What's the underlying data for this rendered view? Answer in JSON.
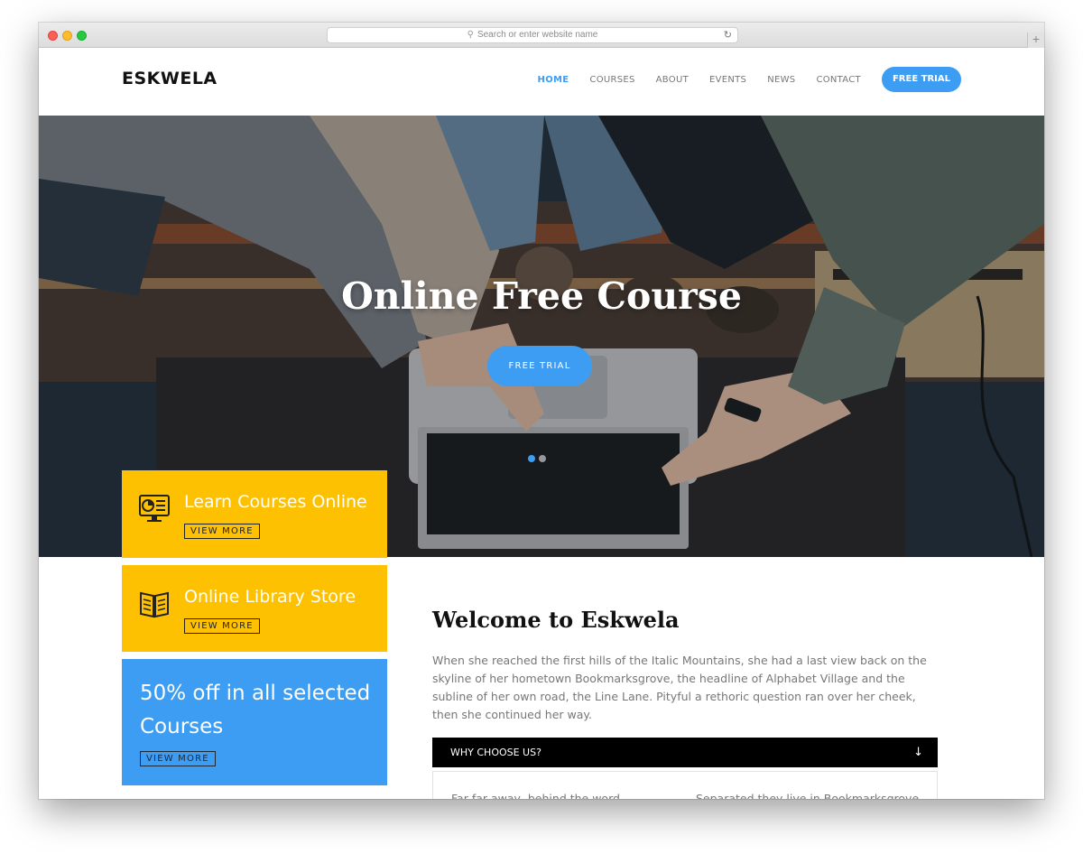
{
  "browser": {
    "address_placeholder": "Search or enter website name",
    "new_tab_label": "+"
  },
  "site": {
    "logo": "ESKWELA",
    "nav": [
      "HOME",
      "COURSES",
      "ABOUT",
      "EVENTS",
      "NEWS",
      "CONTACT"
    ],
    "nav_active": "HOME",
    "cta": "FREE TRIAL"
  },
  "hero": {
    "title": "Online Free Course",
    "button": "FREE TRIAL",
    "slides": 2,
    "active_slide": 1
  },
  "features": [
    {
      "title": "Learn Courses Online",
      "button": "VIEW MORE",
      "icon": "monitor-chart-icon"
    },
    {
      "title": "Online Library Store",
      "button": "VIEW MORE",
      "icon": "book-icon"
    },
    {
      "title": "50% off in all selected Courses",
      "button": "VIEW MORE"
    }
  ],
  "welcome": {
    "title": "Welcome to Eskwela",
    "body": "When she reached the first hills of the Italic Mountains, she had a last view back on the skyline of her hometown Bookmarksgrove, the headline of Alphabet Village and the subline of her own road, the Line Lane. Pityful a rethoric question ran over her cheek, then she continued her way.",
    "accordion": {
      "title": "WHY CHOOSE US?",
      "col1": "Far far away, behind the word",
      "col2": "Separated they live in Bookmarksgrove"
    }
  },
  "colors": {
    "accent_blue": "#3d9df3",
    "accent_yellow": "#fec102",
    "dark": "#000000"
  }
}
